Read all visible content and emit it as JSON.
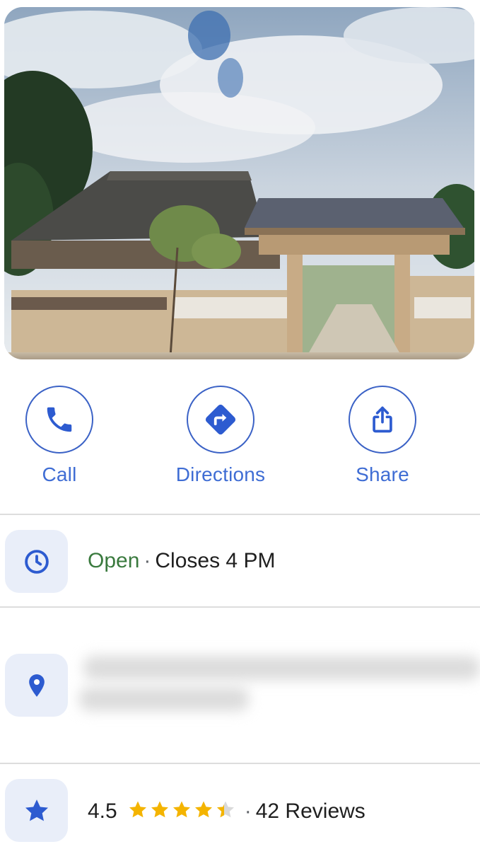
{
  "actions": {
    "call": {
      "label": "Call",
      "icon": "phone-icon"
    },
    "directions": {
      "label": "Directions",
      "icon": "directions-icon"
    },
    "share": {
      "label": "Share",
      "icon": "share-icon"
    }
  },
  "hours": {
    "icon": "clock-icon",
    "status": "Open",
    "separator": "·",
    "closes": "Closes 4 PM"
  },
  "address": {
    "icon": "location-pin-icon",
    "redacted": true
  },
  "rating": {
    "icon": "star-icon",
    "value": "4.5",
    "stars": 4.5,
    "separator": "·",
    "reviews": "42 Reviews"
  },
  "colors": {
    "accent": "#3b62c6",
    "open_green": "#3a7a3e",
    "star_gold": "#f4b400",
    "tile_bg": "#e9eef9"
  }
}
